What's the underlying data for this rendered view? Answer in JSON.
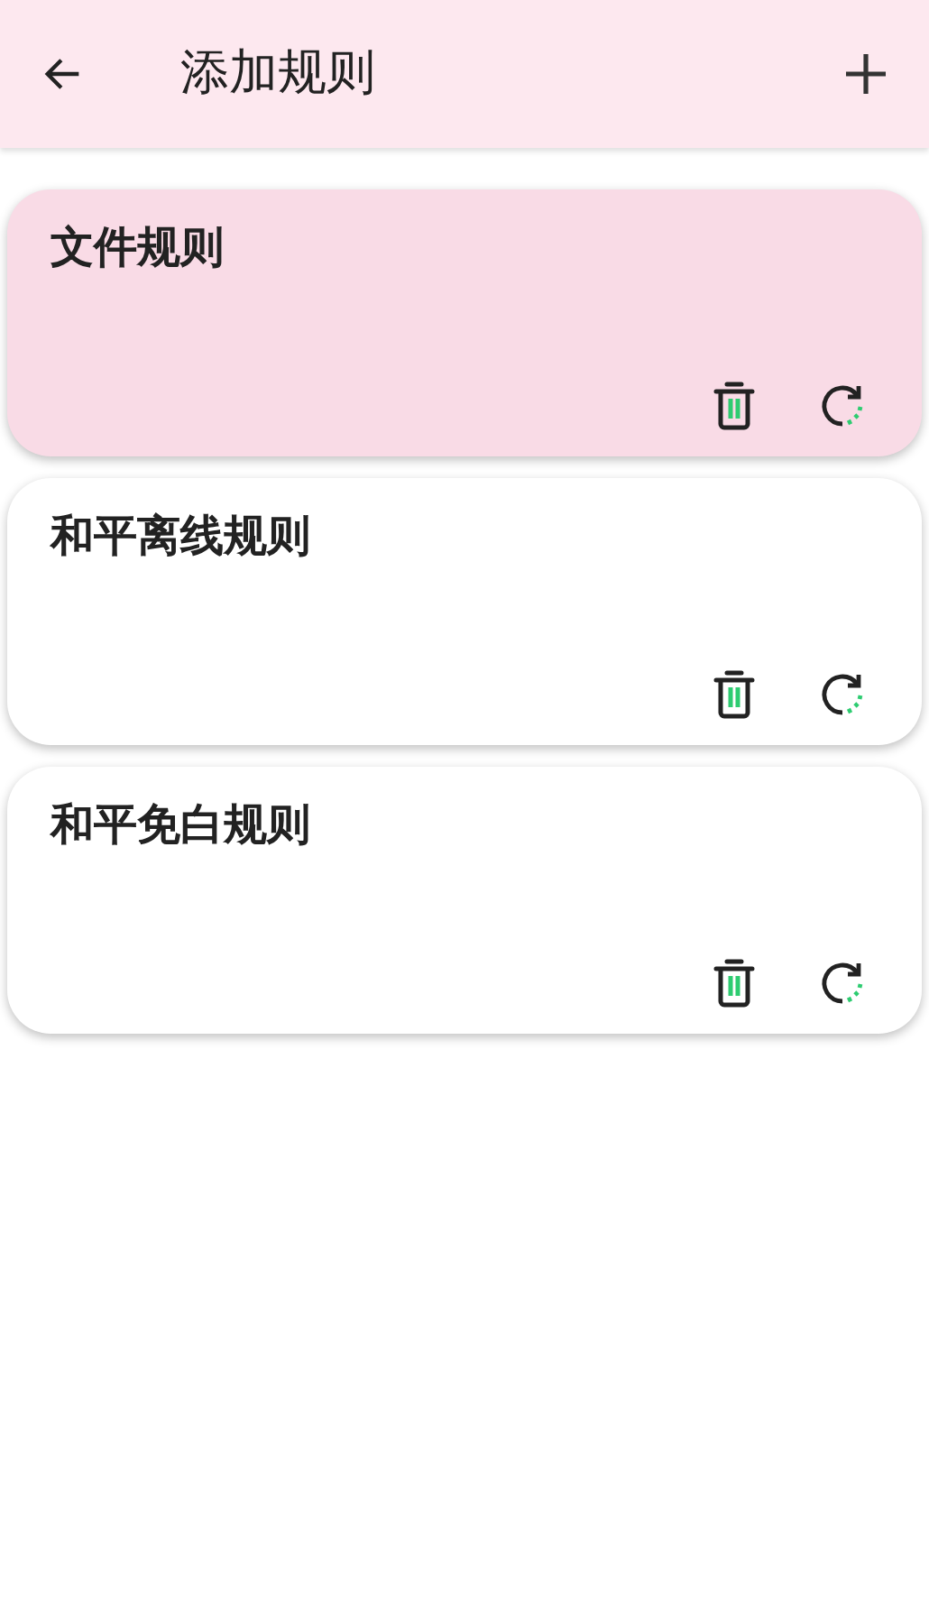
{
  "app_bar": {
    "title": "添加规则"
  },
  "rules": [
    {
      "name": "文件规则",
      "selected": true
    },
    {
      "name": "和平离线规则",
      "selected": false
    },
    {
      "name": "和平免白规则",
      "selected": false
    }
  ]
}
